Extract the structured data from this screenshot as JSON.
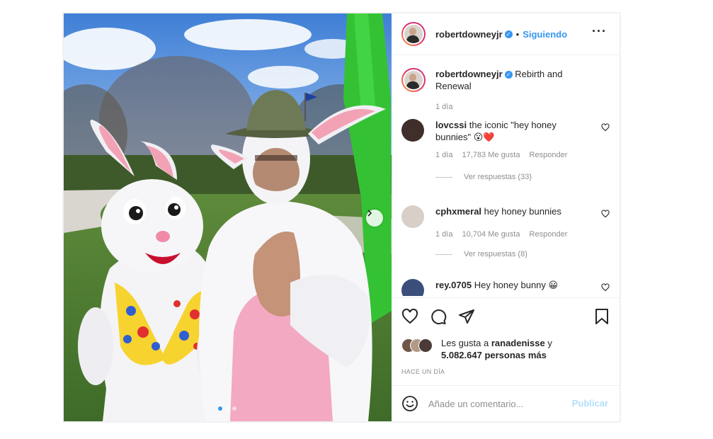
{
  "post": {
    "username": "robertdowneyjr",
    "follow_label": "Siguiendo",
    "caption": "Rebirth and Renewal",
    "caption_time": "1 día",
    "more_icon": "more-options-icon",
    "verified_icon": "verified-badge-icon"
  },
  "comments": [
    {
      "username": "lovcssi",
      "text": "the iconic \"hey honey bunnies\" 😮❤️",
      "time": "1 día",
      "likes": "17,783 Me gusta",
      "reply": "Responder",
      "view_replies": "Ver respuestas (33)"
    },
    {
      "username": "cphxmeral",
      "text": "hey honey bunnies",
      "time": "1 día",
      "likes": "10,704 Me gusta",
      "reply": "Responder",
      "view_replies": "Ver respuestas (8)"
    },
    {
      "username": "rey.0705",
      "text": "Hey honey bunny 😀"
    }
  ],
  "likes": {
    "prefix": "Les gusta a",
    "liker": "ranadenisse",
    "conjunction": "y",
    "others": "5.082.647 personas más"
  },
  "post_time": "HACE UN DÍA",
  "comment_box": {
    "placeholder": "Añade un comentario...",
    "publish_label": "Publicar"
  },
  "carousel": {
    "current_slide": 1,
    "total_slides": 3
  },
  "colors": {
    "accent": "#3897f0",
    "text": "#262626",
    "muted": "#8e8e8e",
    "publish_disabled": "#b2dffc"
  }
}
